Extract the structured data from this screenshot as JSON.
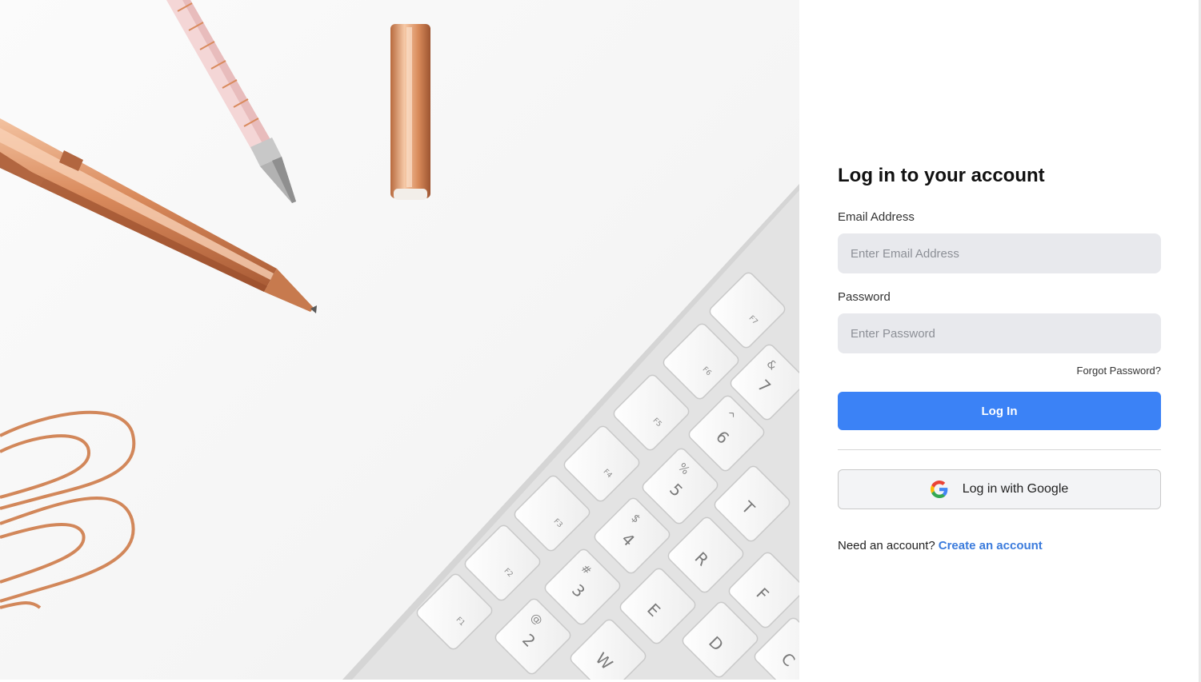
{
  "login": {
    "title": "Log in to your account",
    "email_label": "Email Address",
    "email_placeholder": "Enter Email Address",
    "email_value": "",
    "password_label": "Password",
    "password_placeholder": "Enter Password",
    "password_value": "",
    "forgot_link": "Forgot Password?",
    "submit_label": "Log In",
    "google_label": "Log in with Google",
    "signup_prompt": "Need an account?",
    "signup_link": "Create an account"
  },
  "hero": {
    "description_icons": [
      "pen-icon",
      "pencil-icon",
      "pen-cap-icon",
      "paperclip-icon",
      "keyboard-icon"
    ],
    "keys": [
      {
        "name": "key-f1",
        "main": "",
        "sub": "F1"
      },
      {
        "name": "key-f2",
        "main": "",
        "sub": "F2"
      },
      {
        "name": "key-f3",
        "main": "",
        "sub": "F3"
      },
      {
        "name": "key-f4",
        "main": "",
        "sub": "F4"
      },
      {
        "name": "key-f5",
        "main": "",
        "sub": "F5"
      },
      {
        "name": "key-f6",
        "main": "",
        "sub": "F6"
      },
      {
        "name": "key-f7",
        "main": "",
        "sub": "F7"
      },
      {
        "name": "key-2",
        "main": "2",
        "sub": "@"
      },
      {
        "name": "key-3",
        "main": "3",
        "sub": "#"
      },
      {
        "name": "key-4",
        "main": "4",
        "sub": "$"
      },
      {
        "name": "key-5",
        "main": "5",
        "sub": "%"
      },
      {
        "name": "key-6",
        "main": "6",
        "sub": "^"
      },
      {
        "name": "key-7",
        "main": "7",
        "sub": "&"
      },
      {
        "name": "key-w",
        "main": "W",
        "sub": ""
      },
      {
        "name": "key-e",
        "main": "E",
        "sub": ""
      },
      {
        "name": "key-r",
        "main": "R",
        "sub": ""
      },
      {
        "name": "key-t",
        "main": "T",
        "sub": ""
      },
      {
        "name": "key-d",
        "main": "D",
        "sub": ""
      },
      {
        "name": "key-f",
        "main": "F",
        "sub": ""
      },
      {
        "name": "key-c",
        "main": "C",
        "sub": ""
      }
    ]
  },
  "colors": {
    "primary": "#3b82f6",
    "link": "#3b7bdc",
    "input_bg": "#e8e9ed",
    "rose_gold": "#d9895f"
  }
}
